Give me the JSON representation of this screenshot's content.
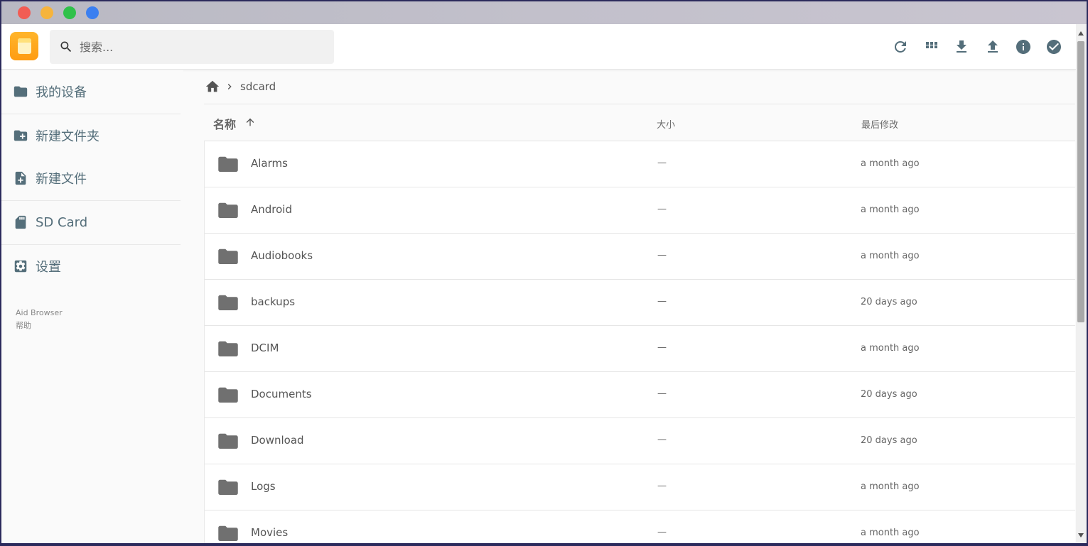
{
  "header": {
    "search_placeholder": "搜索..."
  },
  "toolbar": {
    "icons": [
      "refresh-icon",
      "grid-view-icon",
      "download-icon",
      "upload-icon",
      "info-icon",
      "select-check-icon"
    ]
  },
  "sidebar": {
    "items": [
      {
        "label": "我的设备",
        "icon": "folder-icon"
      },
      {
        "label": "新建文件夹",
        "icon": "new-folder-icon"
      },
      {
        "label": "新建文件",
        "icon": "new-file-icon"
      },
      {
        "label": "SD Card",
        "icon": "sd-card-icon"
      },
      {
        "label": "设置",
        "icon": "settings-icon"
      }
    ],
    "footer": {
      "app_name": "Aid Browser",
      "help": "帮助"
    }
  },
  "breadcrumb": {
    "current": "sdcard"
  },
  "table": {
    "columns": {
      "name": "名称",
      "size": "大小",
      "modified": "最后修改"
    },
    "rows": [
      {
        "name": "Alarms",
        "size": "—",
        "modified": "a month ago"
      },
      {
        "name": "Android",
        "size": "—",
        "modified": "a month ago"
      },
      {
        "name": "Audiobooks",
        "size": "—",
        "modified": "a month ago"
      },
      {
        "name": "backups",
        "size": "—",
        "modified": "20 days ago"
      },
      {
        "name": "DCIM",
        "size": "—",
        "modified": "a month ago"
      },
      {
        "name": "Documents",
        "size": "—",
        "modified": "20 days ago"
      },
      {
        "name": "Download",
        "size": "—",
        "modified": "20 days ago"
      },
      {
        "name": "Logs",
        "size": "—",
        "modified": "a month ago"
      },
      {
        "name": "Movies",
        "size": "—",
        "modified": "a month ago"
      }
    ]
  },
  "colors": {
    "icon_gray": "#546e7a",
    "folder_gray": "#707070",
    "logo_orange": "#ff9c12"
  }
}
